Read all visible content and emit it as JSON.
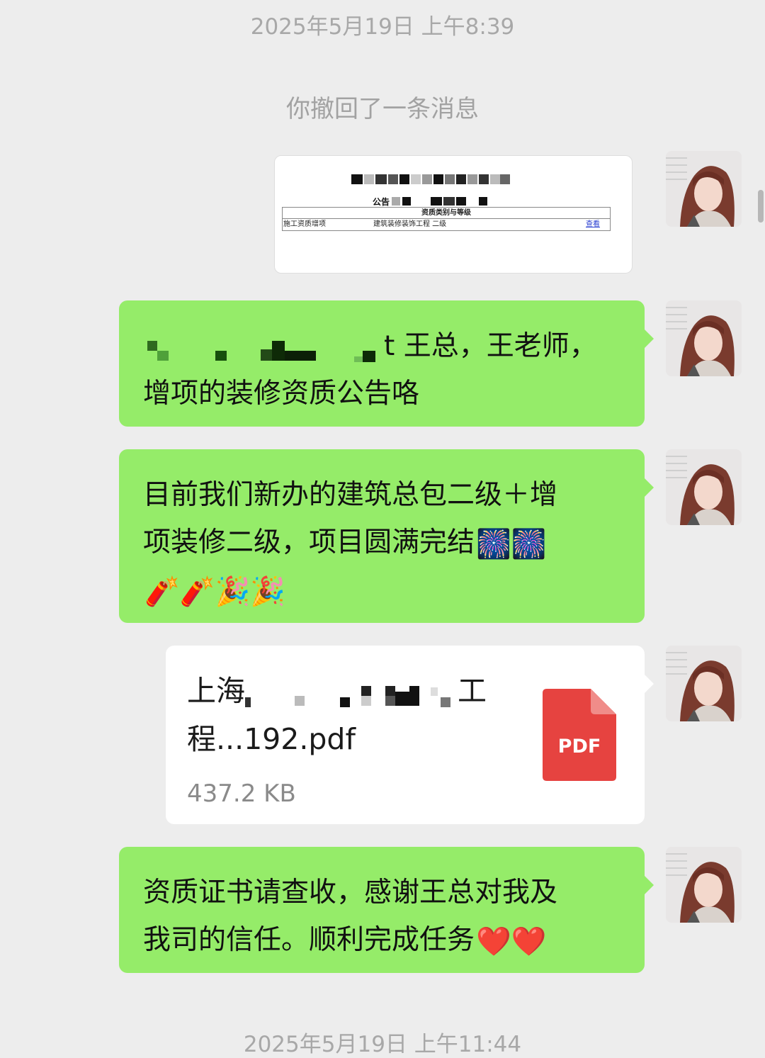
{
  "timestamps": [
    "2025年5月19日 上午8:39",
    "2025年5月19日 上午11:44"
  ],
  "system_message": "你撤回了一条消息",
  "image_message": {
    "doc_title": "公告",
    "table_header": "资质类别与等级",
    "row_col1": "施工资质增项",
    "row_col2": "建筑装修装饰工程 二级",
    "row_link": "查看"
  },
  "messages": [
    {
      "line1_suffix": "t 王总，王老师，",
      "line2": "增项的装修资质公告咯"
    },
    {
      "line1": "目前我们新办的建筑总包二级＋增",
      "line2": "项装修二级，项目圆满完结",
      "emojis_line2": "🎆🎆",
      "emojis_line3": "🧨🧨🎉🎉"
    },
    {
      "line1": "资质证书请查收，感谢王总对我及",
      "line2": "我司的信任。顺利完成任务",
      "emojis": "❤️❤️"
    }
  ],
  "file_message": {
    "name_prefix": "上海",
    "name_suffix": "工",
    "name_line2": "程...192.pdf",
    "size": "437.2 KB",
    "icon_label": "PDF",
    "icon": "pdf-file-icon"
  },
  "colors": {
    "bubble_green": "#95ec69",
    "background": "#ededed",
    "pdf_red": "#e64340"
  }
}
